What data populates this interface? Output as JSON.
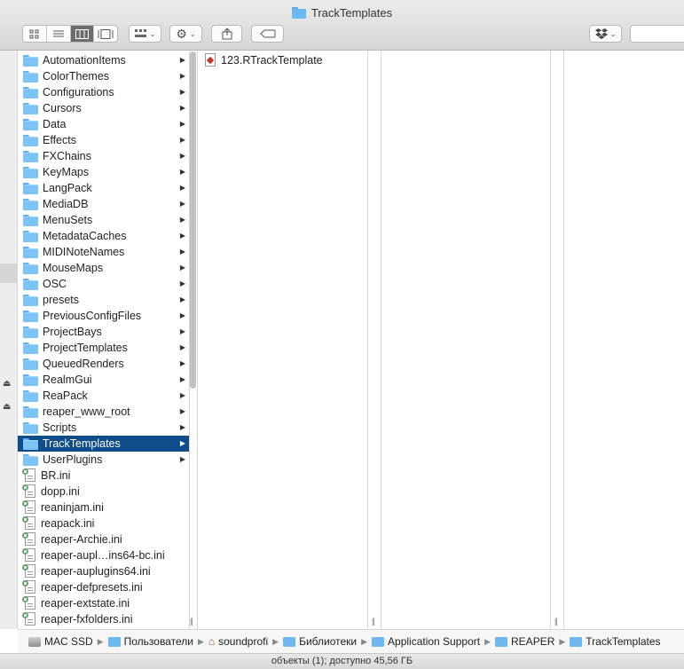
{
  "window": {
    "title": "TrackTemplates"
  },
  "toolbar": {
    "views": [
      "icon-view",
      "list-view",
      "column-view",
      "gallery-view"
    ],
    "active_view": "column-view"
  },
  "column1": {
    "items": [
      {
        "label": "AutomationItems",
        "kind": "folder"
      },
      {
        "label": "ColorThemes",
        "kind": "folder"
      },
      {
        "label": "Configurations",
        "kind": "folder"
      },
      {
        "label": "Cursors",
        "kind": "folder"
      },
      {
        "label": "Data",
        "kind": "folder"
      },
      {
        "label": "Effects",
        "kind": "folder"
      },
      {
        "label": "FXChains",
        "kind": "folder"
      },
      {
        "label": "KeyMaps",
        "kind": "folder"
      },
      {
        "label": "LangPack",
        "kind": "folder"
      },
      {
        "label": "MediaDB",
        "kind": "folder"
      },
      {
        "label": "MenuSets",
        "kind": "folder"
      },
      {
        "label": "MetadataCaches",
        "kind": "folder"
      },
      {
        "label": "MIDINoteNames",
        "kind": "folder"
      },
      {
        "label": "MouseMaps",
        "kind": "folder"
      },
      {
        "label": "OSC",
        "kind": "folder"
      },
      {
        "label": "presets",
        "kind": "folder"
      },
      {
        "label": "PreviousConfigFiles",
        "kind": "folder"
      },
      {
        "label": "ProjectBays",
        "kind": "folder"
      },
      {
        "label": "ProjectTemplates",
        "kind": "folder"
      },
      {
        "label": "QueuedRenders",
        "kind": "folder"
      },
      {
        "label": "RealmGui",
        "kind": "folder"
      },
      {
        "label": "ReaPack",
        "kind": "folder"
      },
      {
        "label": "reaper_www_root",
        "kind": "folder"
      },
      {
        "label": "Scripts",
        "kind": "folder"
      },
      {
        "label": "TrackTemplates",
        "kind": "folder",
        "selected": true
      },
      {
        "label": "UserPlugins",
        "kind": "folder"
      },
      {
        "label": "BR.ini",
        "kind": "file"
      },
      {
        "label": "dopp.ini",
        "kind": "file"
      },
      {
        "label": "reaninjam.ini",
        "kind": "file"
      },
      {
        "label": "reapack.ini",
        "kind": "file"
      },
      {
        "label": "reaper-Archie.ini",
        "kind": "file"
      },
      {
        "label": "reaper-aupl…ins64-bc.ini",
        "kind": "file"
      },
      {
        "label": "reaper-auplugins64.ini",
        "kind": "file"
      },
      {
        "label": "reaper-defpresets.ini",
        "kind": "file"
      },
      {
        "label": "reaper-extstate.ini",
        "kind": "file"
      },
      {
        "label": "reaper-fxfolders.ini",
        "kind": "file"
      }
    ]
  },
  "column2": {
    "items": [
      {
        "label": "123.RTrackTemplate",
        "kind": "rtracktemplate"
      }
    ]
  },
  "pathbar": {
    "crumbs": [
      {
        "label": "MAC SSD",
        "icon": "disk-icon"
      },
      {
        "label": "Пользователи",
        "icon": "folder-icon"
      },
      {
        "label": "soundprofi",
        "icon": "home-icon"
      },
      {
        "label": "Библиотеки",
        "icon": "folder-icon"
      },
      {
        "label": "Application Support",
        "icon": "folder-icon"
      },
      {
        "label": "REAPER",
        "icon": "folder-icon"
      },
      {
        "label": "TrackTemplates",
        "icon": "folder-icon"
      }
    ]
  },
  "status": {
    "text": "объекты (1); доступно 45,56 ГБ"
  }
}
